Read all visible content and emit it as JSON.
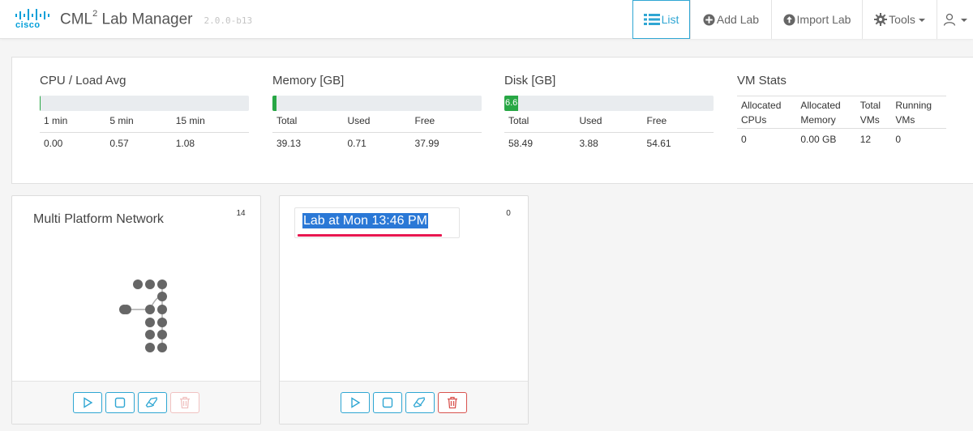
{
  "brand": {
    "logo_text": "cisco",
    "title": "CML",
    "title_sup": "2",
    "title_rest": " Lab Manager",
    "version": "2.0.0-b13"
  },
  "nav": {
    "list": "List",
    "add_lab": "Add Lab",
    "import_lab": "Import Lab",
    "tools": "Tools",
    "user_icon": "user-icon"
  },
  "stats": {
    "cpu": {
      "title": "CPU / Load Avg",
      "bar_percent": 0.4,
      "bar_label": "",
      "headers": [
        "1 min",
        "5 min",
        "15 min"
      ],
      "values": [
        "0.00",
        "0.57",
        "1.08"
      ]
    },
    "memory": {
      "title": "Memory [GB]",
      "bar_percent": 1.8,
      "bar_label": "",
      "headers": [
        "Total",
        "Used",
        "Free"
      ],
      "values": [
        "39.13",
        "0.71",
        "37.99"
      ]
    },
    "disk": {
      "title": "Disk [GB]",
      "bar_percent": 6.6,
      "bar_label": "6.6",
      "headers": [
        "Total",
        "Used",
        "Free"
      ],
      "values": [
        "58.49",
        "3.88",
        "54.61"
      ]
    },
    "vm": {
      "title": "VM Stats",
      "headers": [
        [
          "Allocated",
          "CPUs"
        ],
        [
          "Allocated",
          "Memory"
        ],
        [
          "Total",
          "VMs"
        ],
        [
          "Running",
          "VMs"
        ]
      ],
      "values": [
        "0",
        "0.00 GB",
        "12",
        "0"
      ]
    }
  },
  "labs": [
    {
      "title": "Multi Platform Network",
      "node_count": "14",
      "delete_enabled": false
    },
    {
      "title": "Lab at Mon 13:46 PM",
      "node_count": "0",
      "delete_enabled": true
    }
  ],
  "colors": {
    "accent": "#2fa6d3",
    "bar_fill": "#28a745",
    "danger": "#d9534f",
    "highlight": "#2a78d6",
    "underline": "#e8174f"
  }
}
